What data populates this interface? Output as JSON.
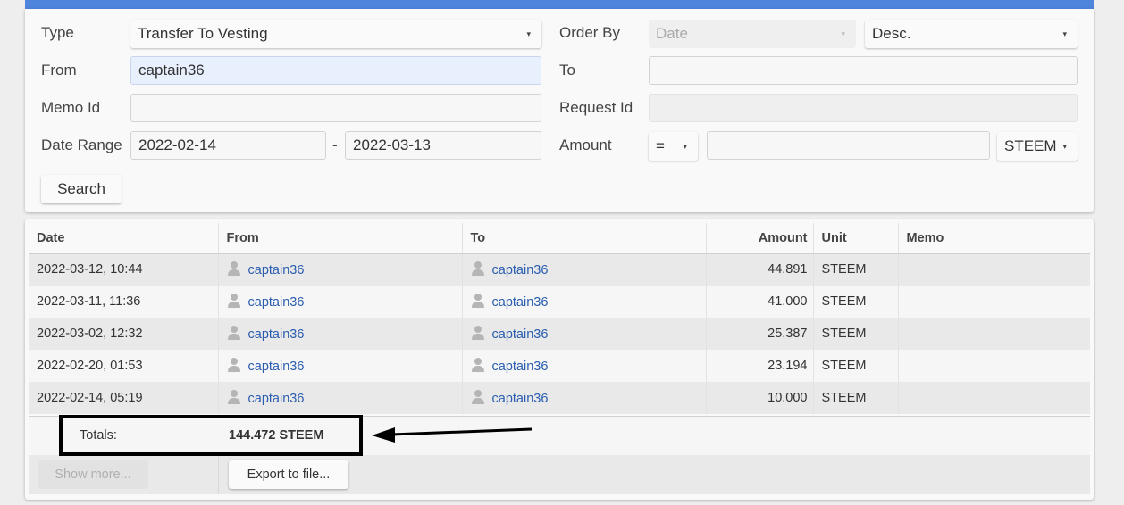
{
  "filters": {
    "type_label": "Type",
    "type_value": "Transfer To Vesting",
    "from_label": "From",
    "from_value": "captain36",
    "memo_label": "Memo Id",
    "memo_value": "",
    "date_range_label": "Date Range",
    "date_from": "2022-02-14",
    "date_separator": "-",
    "date_to": "2022-03-13",
    "order_by_label": "Order By",
    "order_by_value": "Date",
    "order_dir_value": "Desc.",
    "to_label": "To",
    "to_value": "",
    "request_label": "Request Id",
    "request_value": "",
    "amount_label": "Amount",
    "amount_op": "=",
    "amount_value": "",
    "amount_unit": "STEEM",
    "search_button": "Search",
    "caret_glyph": "▾"
  },
  "table": {
    "headers": [
      "Date",
      "From",
      "To",
      "Amount",
      "Unit",
      "Memo"
    ],
    "rows": [
      {
        "date": "2022-03-12, 10:44",
        "from": "captain36",
        "to": "captain36",
        "amount": "44.891",
        "unit": "STEEM",
        "memo": ""
      },
      {
        "date": "2022-03-11, 11:36",
        "from": "captain36",
        "to": "captain36",
        "amount": "41.000",
        "unit": "STEEM",
        "memo": ""
      },
      {
        "date": "2022-03-02, 12:32",
        "from": "captain36",
        "to": "captain36",
        "amount": "25.387",
        "unit": "STEEM",
        "memo": ""
      },
      {
        "date": "2022-02-20, 01:53",
        "from": "captain36",
        "to": "captain36",
        "amount": "23.194",
        "unit": "STEEM",
        "memo": ""
      },
      {
        "date": "2022-02-14, 05:19",
        "from": "captain36",
        "to": "captain36",
        "amount": "10.000",
        "unit": "STEEM",
        "memo": ""
      }
    ],
    "totals_label": "Totals:",
    "totals_value": "144.472 STEEM",
    "show_more": "Show more...",
    "export": "Export to file..."
  },
  "colors": {
    "accent": "#4f85dc",
    "link": "#2a5db0",
    "row_odd": "#e9e9e9",
    "row_even": "#f6f6f6"
  }
}
